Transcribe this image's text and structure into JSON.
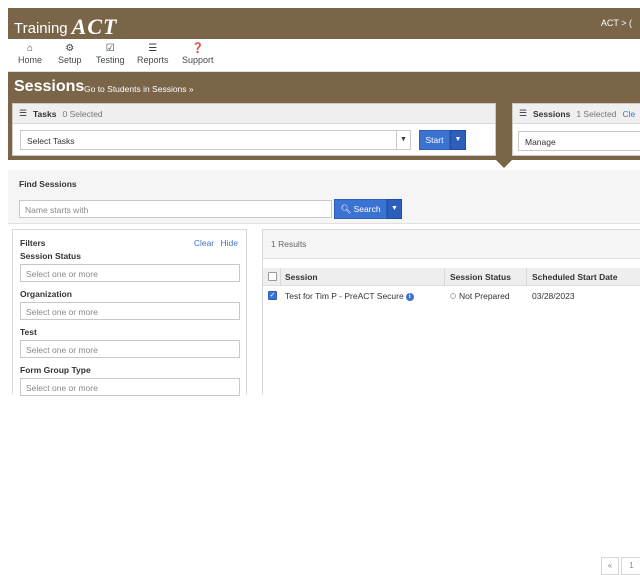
{
  "app": {
    "brand_prefix": "Training",
    "brand_logo": "ACT",
    "top_right": "ACT > ("
  },
  "nav": {
    "items": [
      {
        "label": "Home",
        "icon": "home-icon"
      },
      {
        "label": "Setup",
        "icon": "gear-icon"
      },
      {
        "label": "Testing",
        "icon": "check-square-icon"
      },
      {
        "label": "Reports",
        "icon": "list-icon"
      },
      {
        "label": "Support",
        "icon": "question-icon"
      }
    ]
  },
  "banner": {
    "title": "Sessions",
    "link": "Go to Students in Sessions »"
  },
  "tasks_panel": {
    "title": "Tasks",
    "count": "0 Selected",
    "select_value": "Select Tasks",
    "start_label": "Start"
  },
  "sessions_panel": {
    "title": "Sessions",
    "count": "1 Selected",
    "clear_label": "Cle",
    "select_value": "Manage"
  },
  "find": {
    "title": "Find Sessions",
    "placeholder": "Name starts with",
    "search_label": "Search"
  },
  "filters": {
    "title": "Filters",
    "clear_label": "Clear",
    "hide_label": "Hide",
    "fields": [
      {
        "label": "Session Status",
        "placeholder": "Select one or more"
      },
      {
        "label": "Organization",
        "placeholder": "Select one or more"
      },
      {
        "label": "Test",
        "placeholder": "Select one or more"
      },
      {
        "label": "Form Group Type",
        "placeholder": "Select one or more"
      }
    ]
  },
  "results": {
    "count_text": "1 Results",
    "columns": [
      "Session",
      "Session Status",
      "Scheduled Start Date"
    ],
    "rows": [
      {
        "session": "Test for Tim P - PreACT Secure",
        "status": "Not Prepared",
        "start_date": "03/28/2023",
        "checked": true
      }
    ],
    "pager": {
      "prev": "«",
      "page": "1"
    }
  },
  "colors": {
    "brand_brown": "#7a6549",
    "primary_blue": "#3b73d3"
  }
}
